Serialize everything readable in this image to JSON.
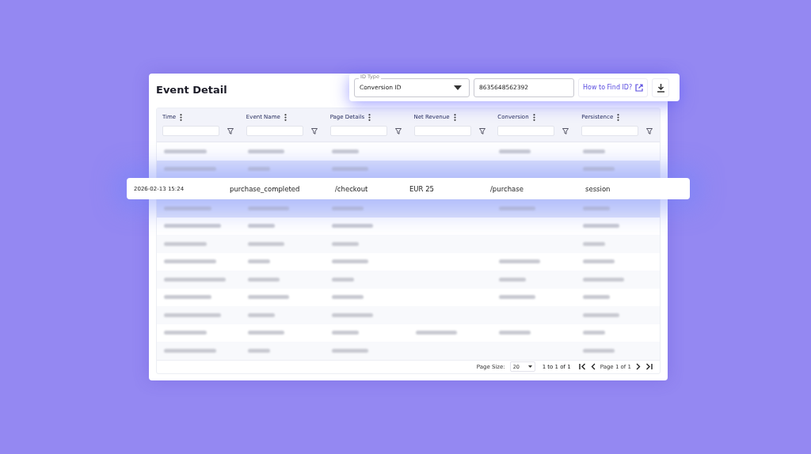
{
  "title": "Event Detail",
  "id_type": {
    "label": "ID Type",
    "value": "Conversion ID"
  },
  "id_value": "8635648562392",
  "help_link": "How to Find ID?",
  "columns": [
    "Time",
    "Event Name",
    "Page Details",
    "Net Revenue",
    "Conversion",
    "Persistence"
  ],
  "rows": [
    {
      "kind": "blurred",
      "filled": [
        true,
        true,
        true,
        false,
        true,
        true
      ]
    },
    {
      "kind": "blurred",
      "filled": [
        true,
        true,
        true,
        false,
        false,
        true
      ]
    },
    {
      "kind": "highlighted",
      "cells": [
        "2026-02-13 15:24",
        "purchase_completed",
        "/checkout",
        "EUR 25",
        "/purchase",
        "session"
      ]
    },
    {
      "kind": "blurred",
      "filled": [
        true,
        true,
        true,
        false,
        true,
        true
      ]
    },
    {
      "kind": "blurred",
      "filled": [
        true,
        true,
        true,
        false,
        false,
        true
      ]
    },
    {
      "kind": "blurred",
      "filled": [
        true,
        true,
        true,
        false,
        false,
        true
      ]
    },
    {
      "kind": "blurred",
      "filled": [
        true,
        true,
        true,
        false,
        true,
        true
      ]
    },
    {
      "kind": "blurred",
      "filled": [
        true,
        true,
        true,
        false,
        true,
        true
      ]
    },
    {
      "kind": "blurred",
      "filled": [
        true,
        true,
        true,
        false,
        true,
        true
      ]
    },
    {
      "kind": "blurred",
      "filled": [
        true,
        true,
        true,
        false,
        false,
        true
      ]
    },
    {
      "kind": "blurred",
      "filled": [
        true,
        true,
        true,
        true,
        true,
        true
      ]
    },
    {
      "kind": "blurred",
      "filled": [
        true,
        true,
        true,
        false,
        false,
        true
      ]
    }
  ],
  "pagination": {
    "page_size_label": "Page Size:",
    "page_size": "20",
    "range": "1 to 1 of 1",
    "page": "Page 1 of 1"
  }
}
